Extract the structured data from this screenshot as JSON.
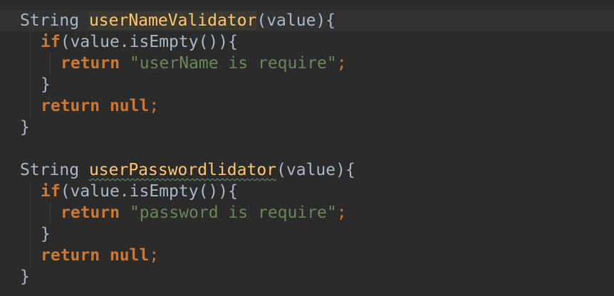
{
  "editor": {
    "lines": [
      {
        "t1": "String ",
        "fn": "userNameValidator",
        "t2": "(value){"
      },
      {
        "kw": "if",
        "t": "(value.isEmpty()){"
      },
      {
        "kw": "return",
        "str": "\"userName is require\"",
        "semi": ";"
      },
      {
        "t": "}"
      },
      {
        "kw": "return",
        "kw2": "null",
        "semi": ";"
      },
      {
        "t": "}"
      },
      {
        "t": ""
      },
      {
        "t1": "String ",
        "fn": "userPasswordlidator",
        "t2": "(value){"
      },
      {
        "kw": "if",
        "t": "(value.isEmpty()){"
      },
      {
        "kw": "return",
        "str": "\"password is require\"",
        "semi": ";"
      },
      {
        "t": "}"
      },
      {
        "kw": "return",
        "kw2": "null",
        "semi": ";"
      },
      {
        "t": "}"
      }
    ]
  }
}
